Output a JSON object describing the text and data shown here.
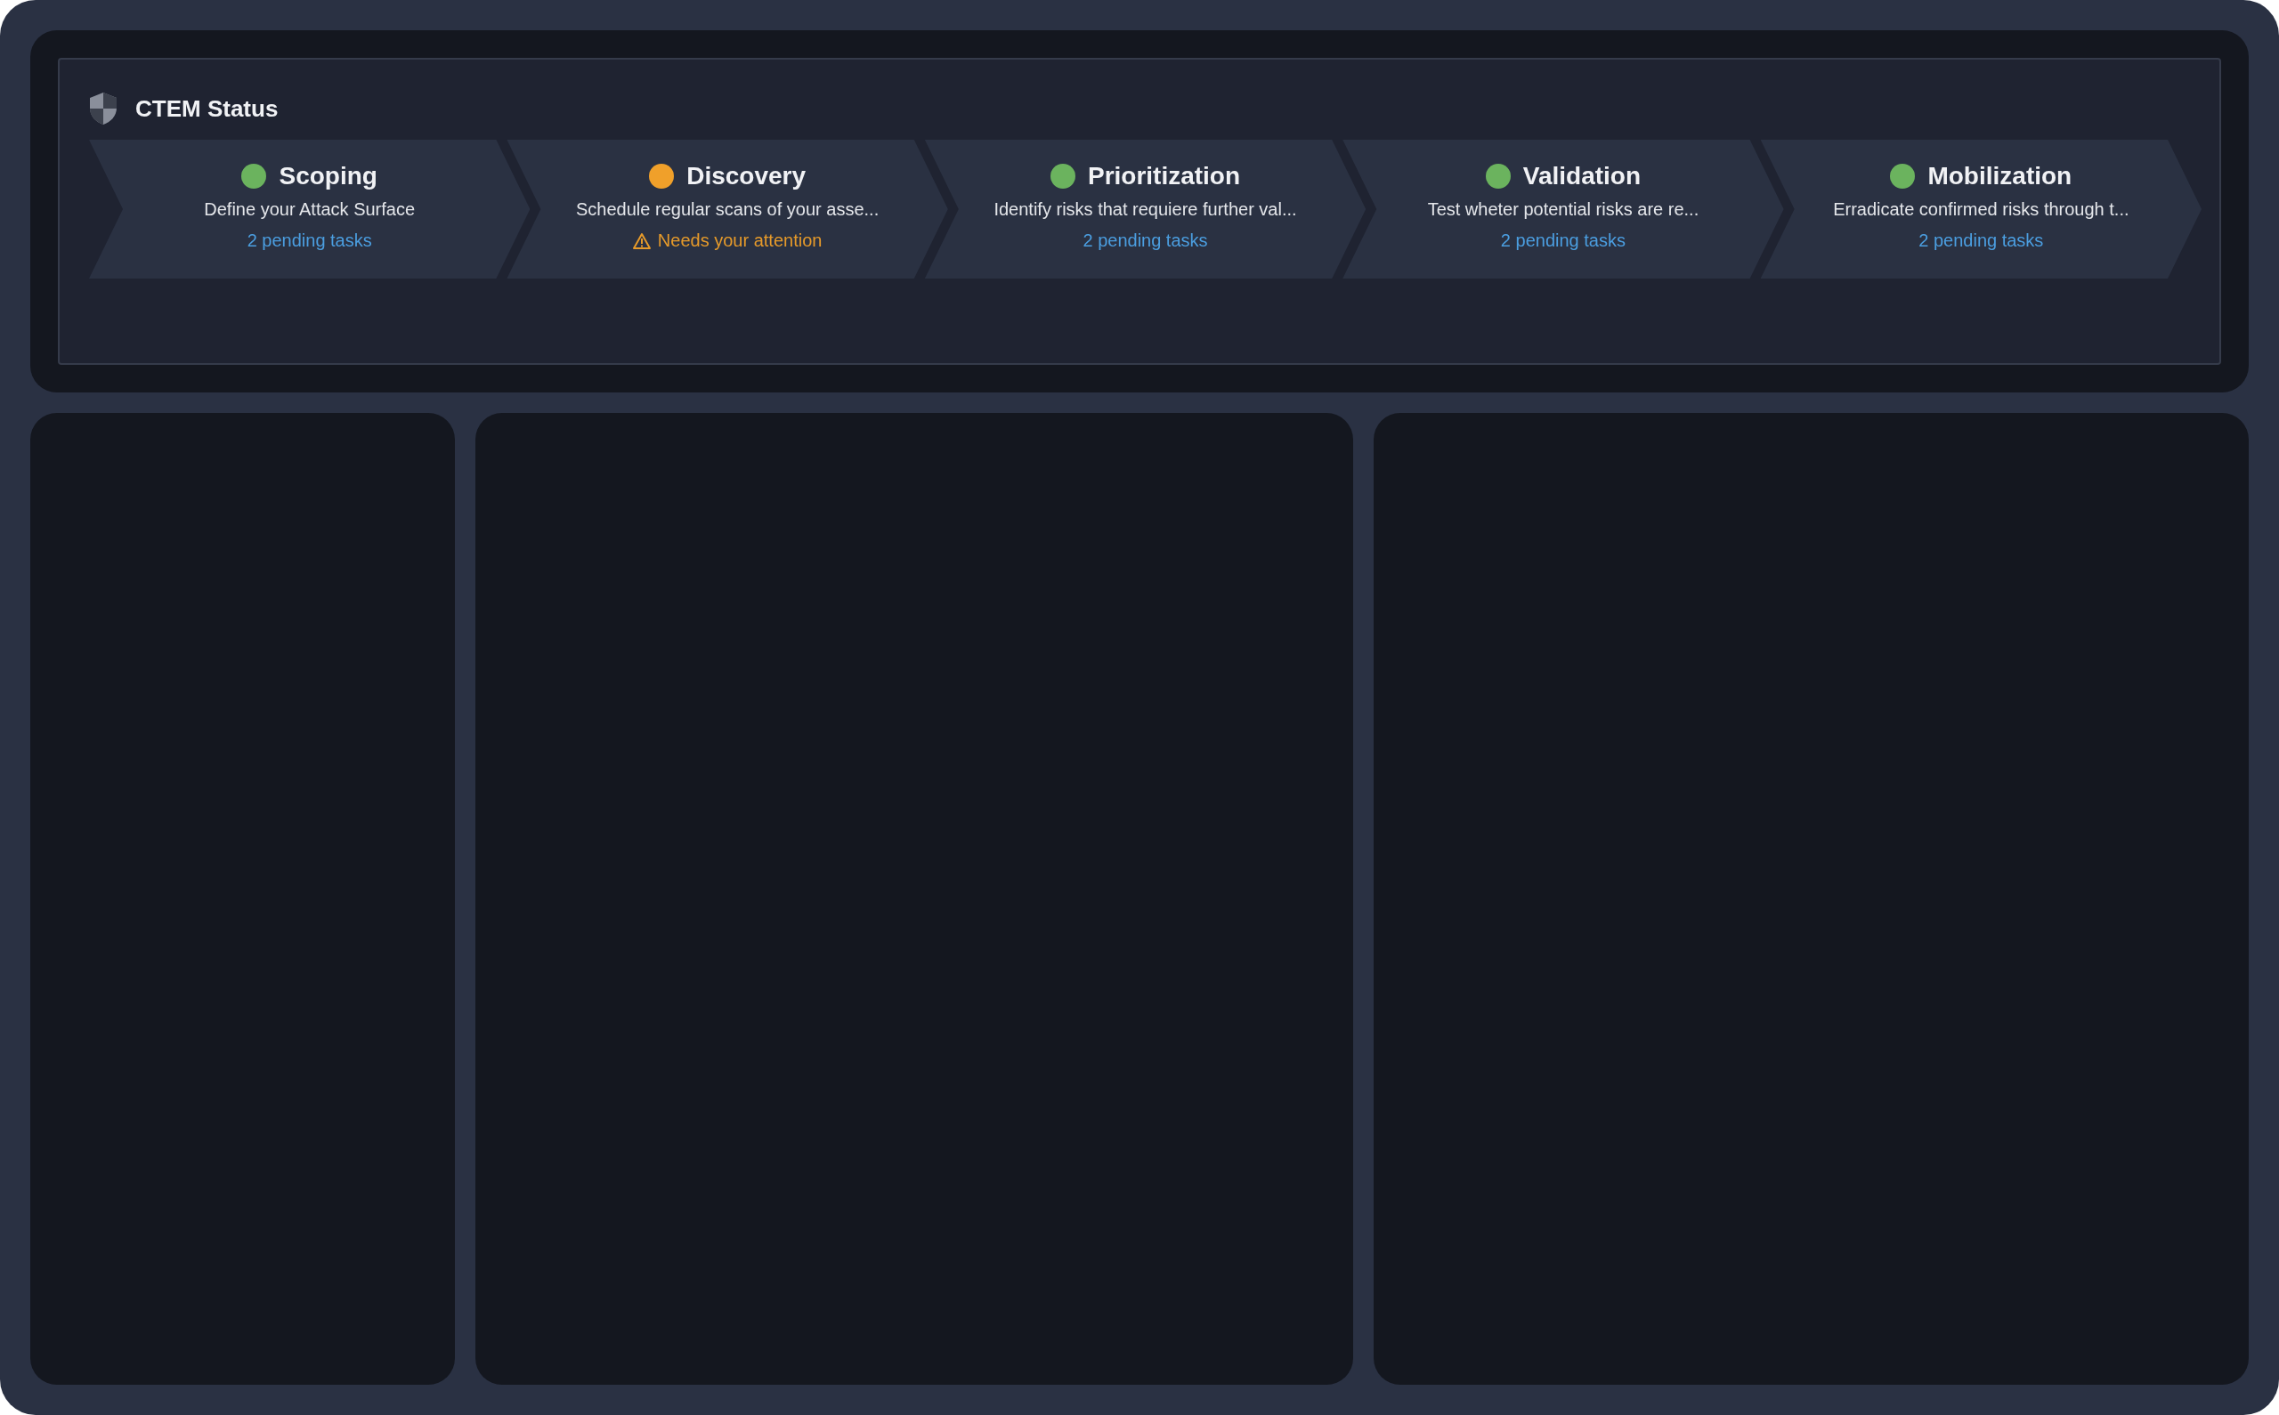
{
  "status_card": {
    "title": "CTEM Status",
    "steps": [
      {
        "title": "Scoping",
        "color": "#6bb35e",
        "description": "Define your Attack Surface",
        "footer": {
          "kind": "tasks",
          "text": "2 pending tasks"
        }
      },
      {
        "title": "Discovery",
        "color": "#f0a02a",
        "description": "Schedule regular scans of your asse...",
        "footer": {
          "kind": "attention",
          "text": "Needs your attention"
        }
      },
      {
        "title": "Prioritization",
        "color": "#6bb35e",
        "description": "Identify risks that requiere further val...",
        "footer": {
          "kind": "tasks",
          "text": "2 pending tasks"
        }
      },
      {
        "title": "Validation",
        "color": "#6bb35e",
        "description": "Test wheter potential risks are re...",
        "footer": {
          "kind": "tasks",
          "text": "2 pending tasks"
        }
      },
      {
        "title": "Mobilization",
        "color": "#6bb35e",
        "description": "Erradicate confirmed risks through t...",
        "footer": {
          "kind": "tasks",
          "text": "2 pending tasks"
        }
      }
    ]
  }
}
